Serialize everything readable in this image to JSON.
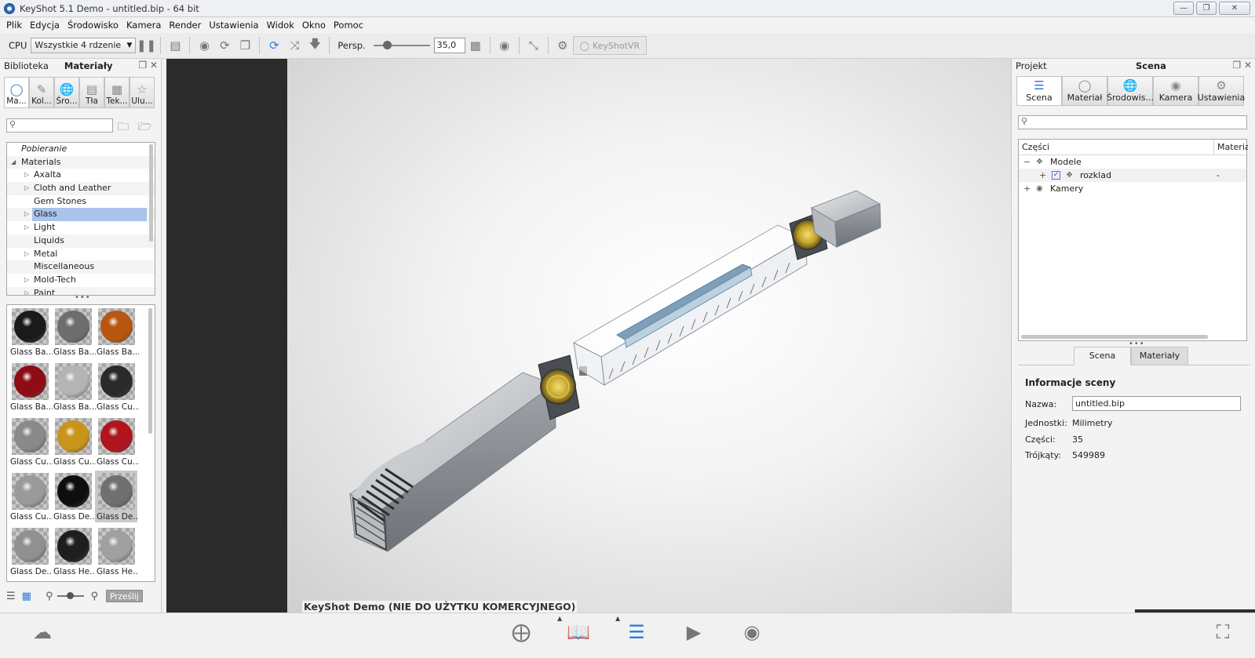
{
  "window": {
    "title": "KeyShot 5.1 Demo  - untitled.bip  - 64 bit",
    "controls": [
      "minimize-icon",
      "restore-icon",
      "close-icon"
    ]
  },
  "menu": [
    "Plik",
    "Edycja",
    "Środowisko",
    "Kamera",
    "Render",
    "Ustawienia",
    "Widok",
    "Okno",
    "Pomoc"
  ],
  "toolbar": {
    "cpu_label": "CPU",
    "cpu_select": "Wszystkie 4 rdzenie",
    "persp_label": "Persp.",
    "persp_value": "35,0",
    "vr_label": "KeyShotVR"
  },
  "library": {
    "tab_library": "Biblioteka",
    "tab_materials": "Materiały",
    "category_tabs": [
      {
        "label": "Ma...",
        "icon": "material-icon",
        "active": true
      },
      {
        "label": "Kol...",
        "icon": "color-icon",
        "active": false
      },
      {
        "label": "Śro...",
        "icon": "globe-icon",
        "active": false
      },
      {
        "label": "Tła",
        "icon": "image-icon",
        "active": false
      },
      {
        "label": "Tek...",
        "icon": "texture-icon",
        "active": false
      },
      {
        "label": "Ulu...",
        "icon": "star-icon",
        "active": false
      }
    ],
    "search_placeholder": "",
    "tree": [
      {
        "label": "Pobieranie",
        "level": 0,
        "italic": true,
        "expander": ""
      },
      {
        "label": "Materials",
        "level": 0,
        "italic": false,
        "expander": "open"
      },
      {
        "label": "Axalta",
        "level": 1,
        "italic": false,
        "expander": "closed"
      },
      {
        "label": "Cloth and Leather",
        "level": 1,
        "italic": false,
        "expander": "closed"
      },
      {
        "label": "Gem Stones",
        "level": 1,
        "italic": false,
        "expander": ""
      },
      {
        "label": "Glass",
        "level": 1,
        "italic": false,
        "expander": "closed",
        "selected": true
      },
      {
        "label": "Light",
        "level": 1,
        "italic": false,
        "expander": "closed"
      },
      {
        "label": "Liquids",
        "level": 1,
        "italic": false,
        "expander": ""
      },
      {
        "label": "Metal",
        "level": 1,
        "italic": false,
        "expander": "closed"
      },
      {
        "label": "Miscellaneous",
        "level": 1,
        "italic": false,
        "expander": ""
      },
      {
        "label": "Mold-Tech",
        "level": 1,
        "italic": false,
        "expander": "closed"
      },
      {
        "label": "Paint",
        "level": 1,
        "italic": false,
        "expander": "closed"
      }
    ],
    "thumbnails": [
      {
        "label": "Glass Ba...",
        "color": "#1a1a1a"
      },
      {
        "label": "Glass Ba...",
        "color": "#6e6e6e"
      },
      {
        "label": "Glass Ba...",
        "color": "#b8560f"
      },
      {
        "label": "Glass Ba...",
        "color": "#8e0c14"
      },
      {
        "label": "Glass Ba...",
        "color": "#b4b4b4"
      },
      {
        "label": "Glass Cu...",
        "color": "#2a2a2a"
      },
      {
        "label": "Glass Cu...",
        "color": "#8a8a8a"
      },
      {
        "label": "Glass Cu...",
        "color": "#c8951a"
      },
      {
        "label": "Glass Cu...",
        "color": "#b0141c"
      },
      {
        "label": "Glass Cu...",
        "color": "#9a9a9a"
      },
      {
        "label": "Glass De...",
        "color": "#0e0e0e"
      },
      {
        "label": "Glass De...",
        "color": "#707070",
        "selected": true
      },
      {
        "label": "Glass De...",
        "color": "#909090"
      },
      {
        "label": "Glass He...",
        "color": "#1e1e1e"
      },
      {
        "label": "Glass He...",
        "color": "#a0a0a0"
      }
    ],
    "send_button": "Prześlij"
  },
  "viewport": {
    "watermark": "KeyShot Demo (NIE DO UŻYTKU KOMERCYJNEGO)"
  },
  "project": {
    "tab_project": "Projekt",
    "tab_scene": "Scena",
    "tabs": [
      {
        "label": "Scena",
        "icon": "list-icon",
        "active": true
      },
      {
        "label": "Materiał",
        "icon": "material-icon",
        "active": false
      },
      {
        "label": "Środowis...",
        "icon": "globe-icon",
        "active": false
      },
      {
        "label": "Kamera",
        "icon": "camera-icon",
        "active": false
      },
      {
        "label": "Ustawienia",
        "icon": "gear-icon",
        "active": false
      }
    ],
    "search_placeholder": "",
    "tree_header": {
      "parts": "Części",
      "material": "Materiał"
    },
    "tree": [
      {
        "label": "Modele",
        "expander": "−",
        "checked": false,
        "value": ""
      },
      {
        "label": "rozklad",
        "expander": "+",
        "checked": true,
        "value": "-"
      },
      {
        "label": "Kamery",
        "expander": "+",
        "checked": false,
        "value": ""
      }
    ],
    "info_tabs": [
      "Scena",
      "Materiały"
    ],
    "info": {
      "title": "Informacje sceny",
      "name_label": "Nazwa:",
      "name_value": "untitled.bip",
      "units_label": "Jednostki:",
      "units_value": "Milimetry",
      "parts_label": "Części:",
      "parts_value": "35",
      "triangles_label": "Trójkąty:",
      "triangles_value": "549989"
    }
  },
  "bottombar": {
    "icons": [
      "cloud-library-icon",
      "import-icon",
      "library-icon",
      "project-icon",
      "animation-icon",
      "screenshot-icon",
      "fullscreen-icon"
    ]
  }
}
